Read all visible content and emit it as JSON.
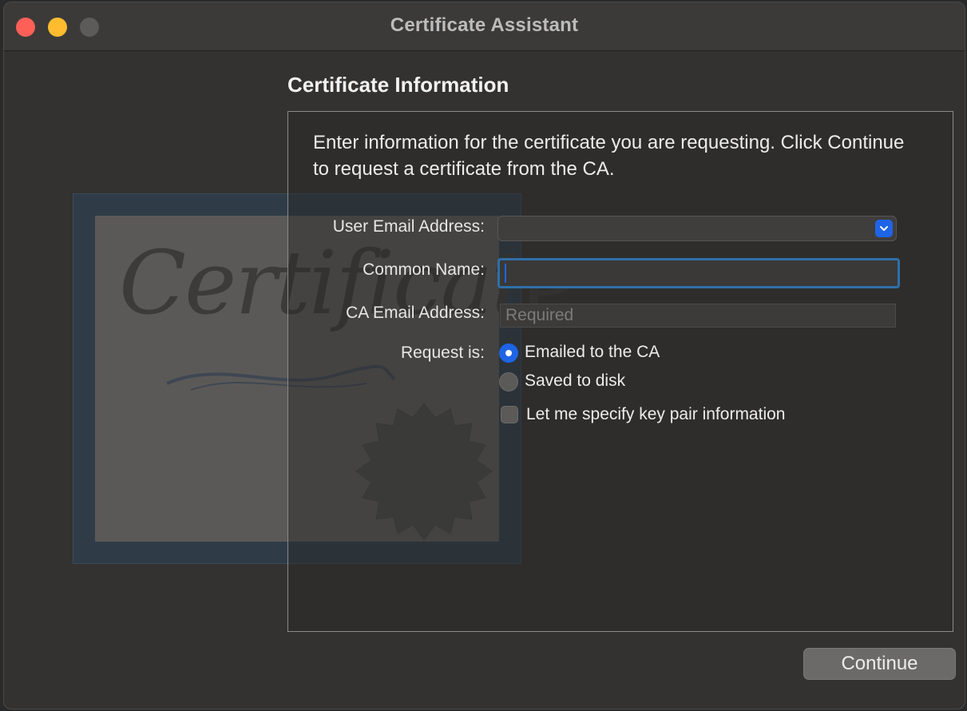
{
  "window": {
    "title": "Certificate Assistant",
    "controls": [
      "close",
      "minimize",
      "zoom"
    ]
  },
  "illustration": {
    "icon": "certificate-illustration",
    "script_text": "Certificate"
  },
  "section": {
    "title": "Certificate Information",
    "intro": "Enter information for the certificate you are requesting. Click Continue to request a certificate from the CA."
  },
  "form": {
    "user_email": {
      "label": "User Email Address:",
      "value": ""
    },
    "common_name": {
      "label": "Common Name:",
      "value": ""
    },
    "ca_email": {
      "label": "CA Email Address:",
      "value": "",
      "placeholder": "Required"
    },
    "request": {
      "label": "Request is:",
      "options": [
        {
          "label": "Emailed to the CA",
          "selected": true
        },
        {
          "label": "Saved to disk",
          "selected": false
        }
      ]
    },
    "key_pair": {
      "label": "Let me specify key pair information",
      "checked": false
    }
  },
  "footer": {
    "continue_label": "Continue"
  },
  "colors": {
    "accent": "#1e64e6",
    "focus_ring": "#2f6fa7",
    "close": "#fe5f57",
    "minimize": "#febc2e"
  }
}
